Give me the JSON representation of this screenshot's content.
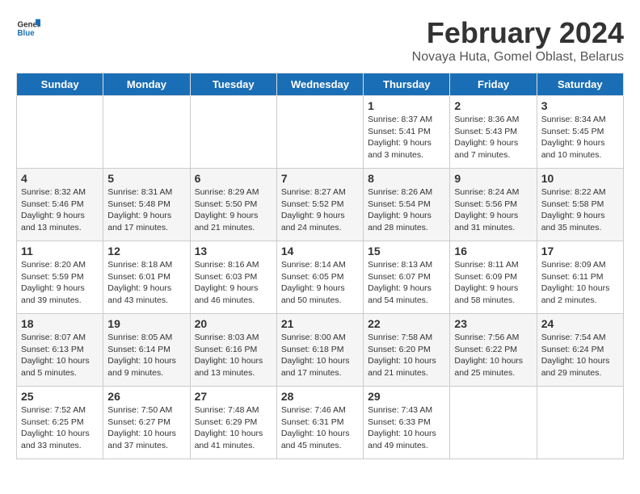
{
  "logo": {
    "general": "General",
    "blue": "Blue"
  },
  "title": "February 2024",
  "subtitle": "Novaya Huta, Gomel Oblast, Belarus",
  "days_of_week": [
    "Sunday",
    "Monday",
    "Tuesday",
    "Wednesday",
    "Thursday",
    "Friday",
    "Saturday"
  ],
  "weeks": [
    [
      {
        "day": "",
        "info": ""
      },
      {
        "day": "",
        "info": ""
      },
      {
        "day": "",
        "info": ""
      },
      {
        "day": "",
        "info": ""
      },
      {
        "day": "1",
        "info": "Sunrise: 8:37 AM\nSunset: 5:41 PM\nDaylight: 9 hours\nand 3 minutes."
      },
      {
        "day": "2",
        "info": "Sunrise: 8:36 AM\nSunset: 5:43 PM\nDaylight: 9 hours\nand 7 minutes."
      },
      {
        "day": "3",
        "info": "Sunrise: 8:34 AM\nSunset: 5:45 PM\nDaylight: 9 hours\nand 10 minutes."
      }
    ],
    [
      {
        "day": "4",
        "info": "Sunrise: 8:32 AM\nSunset: 5:46 PM\nDaylight: 9 hours\nand 13 minutes."
      },
      {
        "day": "5",
        "info": "Sunrise: 8:31 AM\nSunset: 5:48 PM\nDaylight: 9 hours\nand 17 minutes."
      },
      {
        "day": "6",
        "info": "Sunrise: 8:29 AM\nSunset: 5:50 PM\nDaylight: 9 hours\nand 21 minutes."
      },
      {
        "day": "7",
        "info": "Sunrise: 8:27 AM\nSunset: 5:52 PM\nDaylight: 9 hours\nand 24 minutes."
      },
      {
        "day": "8",
        "info": "Sunrise: 8:26 AM\nSunset: 5:54 PM\nDaylight: 9 hours\nand 28 minutes."
      },
      {
        "day": "9",
        "info": "Sunrise: 8:24 AM\nSunset: 5:56 PM\nDaylight: 9 hours\nand 31 minutes."
      },
      {
        "day": "10",
        "info": "Sunrise: 8:22 AM\nSunset: 5:58 PM\nDaylight: 9 hours\nand 35 minutes."
      }
    ],
    [
      {
        "day": "11",
        "info": "Sunrise: 8:20 AM\nSunset: 5:59 PM\nDaylight: 9 hours\nand 39 minutes."
      },
      {
        "day": "12",
        "info": "Sunrise: 8:18 AM\nSunset: 6:01 PM\nDaylight: 9 hours\nand 43 minutes."
      },
      {
        "day": "13",
        "info": "Sunrise: 8:16 AM\nSunset: 6:03 PM\nDaylight: 9 hours\nand 46 minutes."
      },
      {
        "day": "14",
        "info": "Sunrise: 8:14 AM\nSunset: 6:05 PM\nDaylight: 9 hours\nand 50 minutes."
      },
      {
        "day": "15",
        "info": "Sunrise: 8:13 AM\nSunset: 6:07 PM\nDaylight: 9 hours\nand 54 minutes."
      },
      {
        "day": "16",
        "info": "Sunrise: 8:11 AM\nSunset: 6:09 PM\nDaylight: 9 hours\nand 58 minutes."
      },
      {
        "day": "17",
        "info": "Sunrise: 8:09 AM\nSunset: 6:11 PM\nDaylight: 10 hours\nand 2 minutes."
      }
    ],
    [
      {
        "day": "18",
        "info": "Sunrise: 8:07 AM\nSunset: 6:13 PM\nDaylight: 10 hours\nand 5 minutes."
      },
      {
        "day": "19",
        "info": "Sunrise: 8:05 AM\nSunset: 6:14 PM\nDaylight: 10 hours\nand 9 minutes."
      },
      {
        "day": "20",
        "info": "Sunrise: 8:03 AM\nSunset: 6:16 PM\nDaylight: 10 hours\nand 13 minutes."
      },
      {
        "day": "21",
        "info": "Sunrise: 8:00 AM\nSunset: 6:18 PM\nDaylight: 10 hours\nand 17 minutes."
      },
      {
        "day": "22",
        "info": "Sunrise: 7:58 AM\nSunset: 6:20 PM\nDaylight: 10 hours\nand 21 minutes."
      },
      {
        "day": "23",
        "info": "Sunrise: 7:56 AM\nSunset: 6:22 PM\nDaylight: 10 hours\nand 25 minutes."
      },
      {
        "day": "24",
        "info": "Sunrise: 7:54 AM\nSunset: 6:24 PM\nDaylight: 10 hours\nand 29 minutes."
      }
    ],
    [
      {
        "day": "25",
        "info": "Sunrise: 7:52 AM\nSunset: 6:25 PM\nDaylight: 10 hours\nand 33 minutes."
      },
      {
        "day": "26",
        "info": "Sunrise: 7:50 AM\nSunset: 6:27 PM\nDaylight: 10 hours\nand 37 minutes."
      },
      {
        "day": "27",
        "info": "Sunrise: 7:48 AM\nSunset: 6:29 PM\nDaylight: 10 hours\nand 41 minutes."
      },
      {
        "day": "28",
        "info": "Sunrise: 7:46 AM\nSunset: 6:31 PM\nDaylight: 10 hours\nand 45 minutes."
      },
      {
        "day": "29",
        "info": "Sunrise: 7:43 AM\nSunset: 6:33 PM\nDaylight: 10 hours\nand 49 minutes."
      },
      {
        "day": "",
        "info": ""
      },
      {
        "day": "",
        "info": ""
      }
    ]
  ]
}
